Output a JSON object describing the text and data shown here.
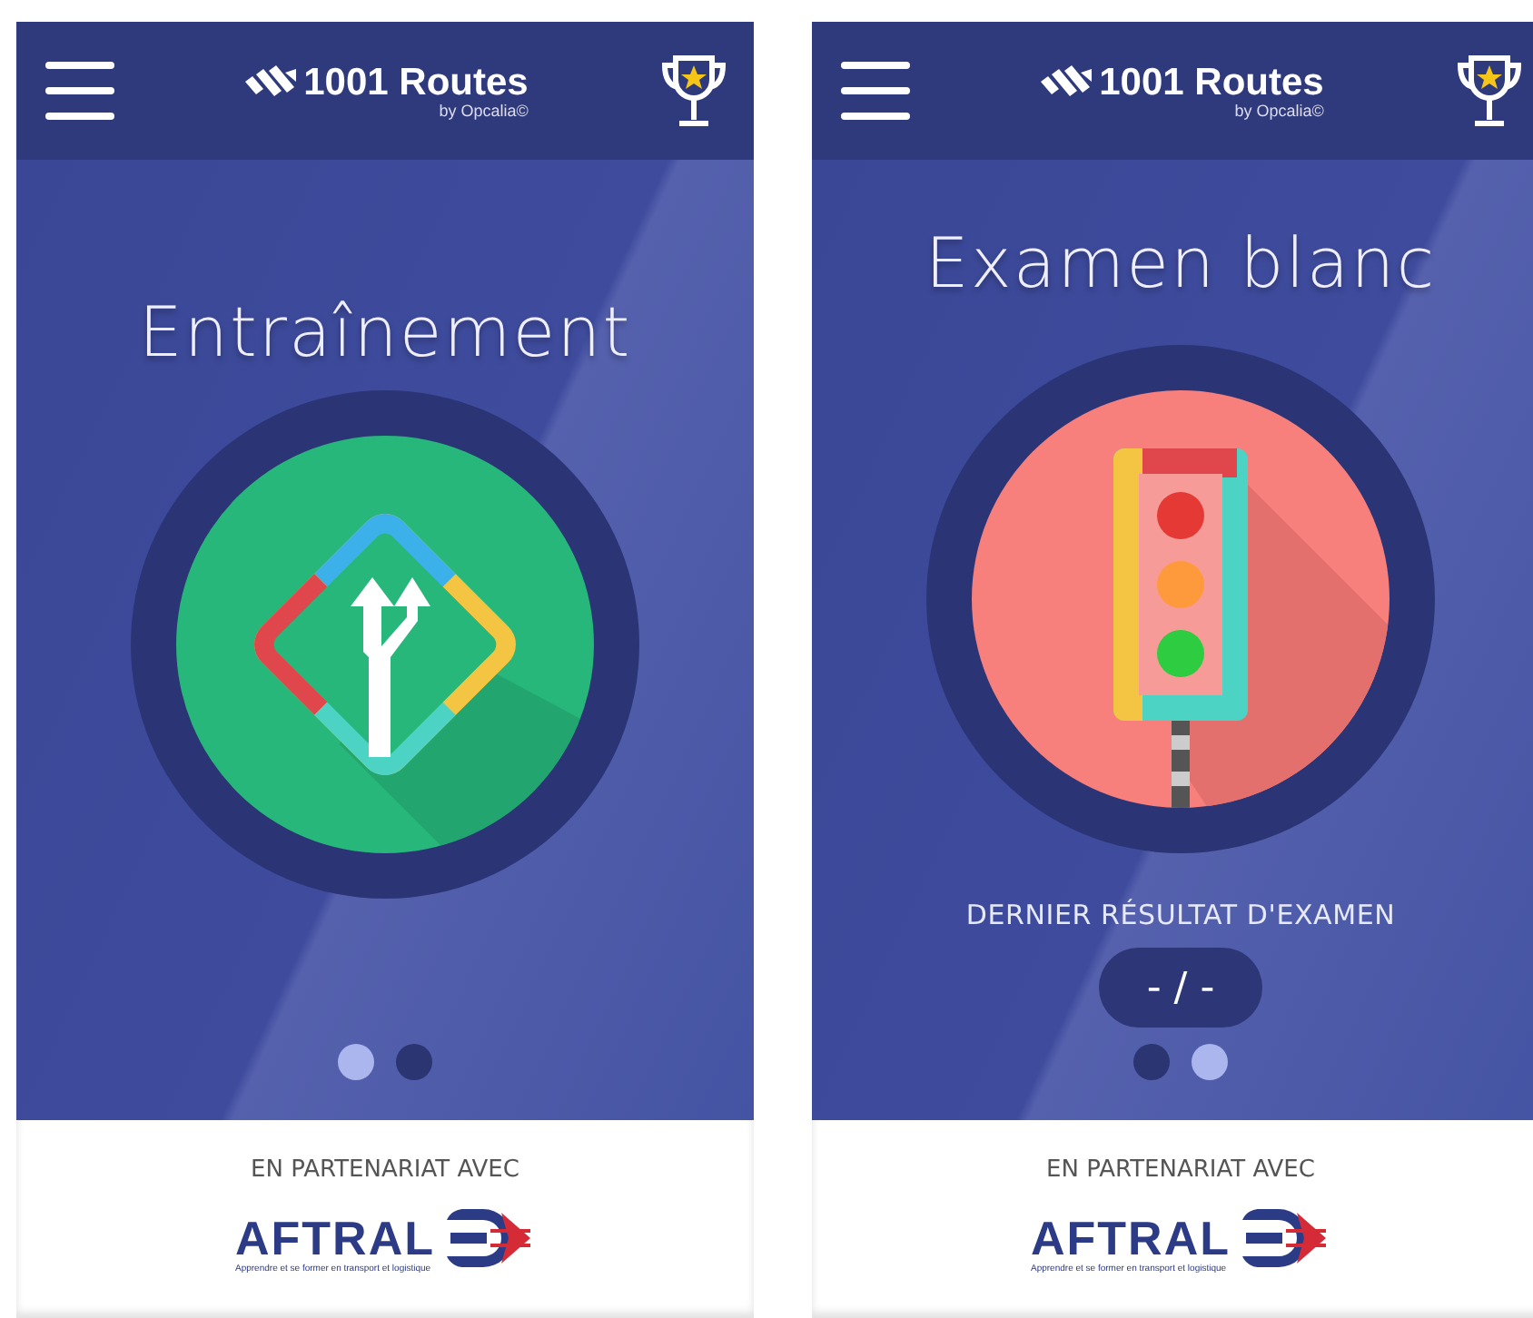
{
  "screens": [
    {
      "kind": "training",
      "app_name": "1001 Routes",
      "app_subtitle": "by Opcalia©",
      "title": "Entraînement",
      "dots": [
        {
          "selected": true
        },
        {
          "selected": false
        }
      ],
      "partner_label": "EN PARTENARIAT AVEC",
      "partner_name": "AFTRAL",
      "partner_tagline": "Apprendre et se former en transport et logistique"
    },
    {
      "kind": "exam",
      "app_name": "1001 Routes",
      "app_subtitle": "by Opcalia©",
      "title": "Examen blanc",
      "result_label": "DERNIER RÉSULTAT D'EXAMEN",
      "result": "- / -",
      "dots": [
        {
          "selected": false
        },
        {
          "selected": true
        }
      ],
      "partner_label": "EN PARTENARIAT AVEC",
      "partner_name": "AFTRAL",
      "partner_tagline": "Apprendre et se former en transport et logistique"
    }
  ]
}
